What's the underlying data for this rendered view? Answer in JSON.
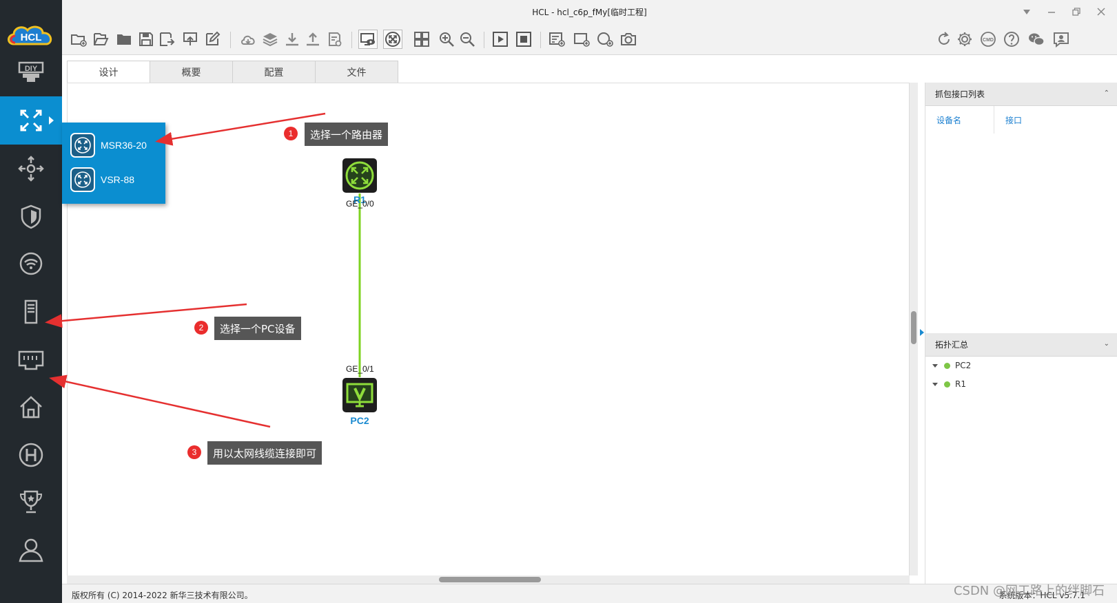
{
  "window": {
    "title": "HCL - hcl_c6p_fMy[临时工程]"
  },
  "tabs": [
    {
      "label": "设计",
      "active": true
    },
    {
      "label": "概要",
      "active": false
    },
    {
      "label": "配置",
      "active": false
    },
    {
      "label": "文件",
      "active": false
    }
  ],
  "sidebar": {
    "logo_text": "HCL",
    "items": [
      {
        "icon": "diy-icon"
      },
      {
        "icon": "router-icon",
        "active": true
      },
      {
        "icon": "switch-icon"
      },
      {
        "icon": "firewall-icon"
      },
      {
        "icon": "wireless-icon"
      },
      {
        "icon": "pc-icon"
      },
      {
        "icon": "ethernet-cable-icon"
      },
      {
        "icon": "home-icon"
      },
      {
        "icon": "h-logo-icon"
      },
      {
        "icon": "trophy-icon"
      },
      {
        "icon": "user-icon"
      }
    ]
  },
  "popup": {
    "items": [
      {
        "label": "MSR36-20"
      },
      {
        "label": "VSR-88"
      }
    ]
  },
  "topology": {
    "nodes": [
      {
        "name": "R1",
        "type": "router"
      },
      {
        "name": "PC2",
        "type": "pc"
      }
    ],
    "link": {
      "port_a": "GE_0/0",
      "port_b": "GE_0/1",
      "color": "#7ed321"
    }
  },
  "annotations": [
    {
      "num": "1",
      "text": "选择一个路由器"
    },
    {
      "num": "2",
      "text": "选择一个PC设备"
    },
    {
      "num": "3",
      "text": "用以太网线缆连接即可"
    }
  ],
  "right_panel": {
    "capture": {
      "title": "抓包接口列表",
      "col_device": "设备名",
      "col_interface": "接口"
    },
    "topo_summary": {
      "title": "拓扑汇总",
      "items": [
        "PC2",
        "R1"
      ]
    }
  },
  "status": {
    "copyright": "版权所有 (C) 2014-2022 新华三技术有限公司。",
    "version": "系统版本：HCL v5.7.1"
  },
  "watermark": "CSDN @网工路上的绊脚石",
  "colors": {
    "accent": "#0b8ed0",
    "sidebar": "#23292e",
    "link": "#7ed321",
    "annotation_arrow": "#e53030"
  }
}
